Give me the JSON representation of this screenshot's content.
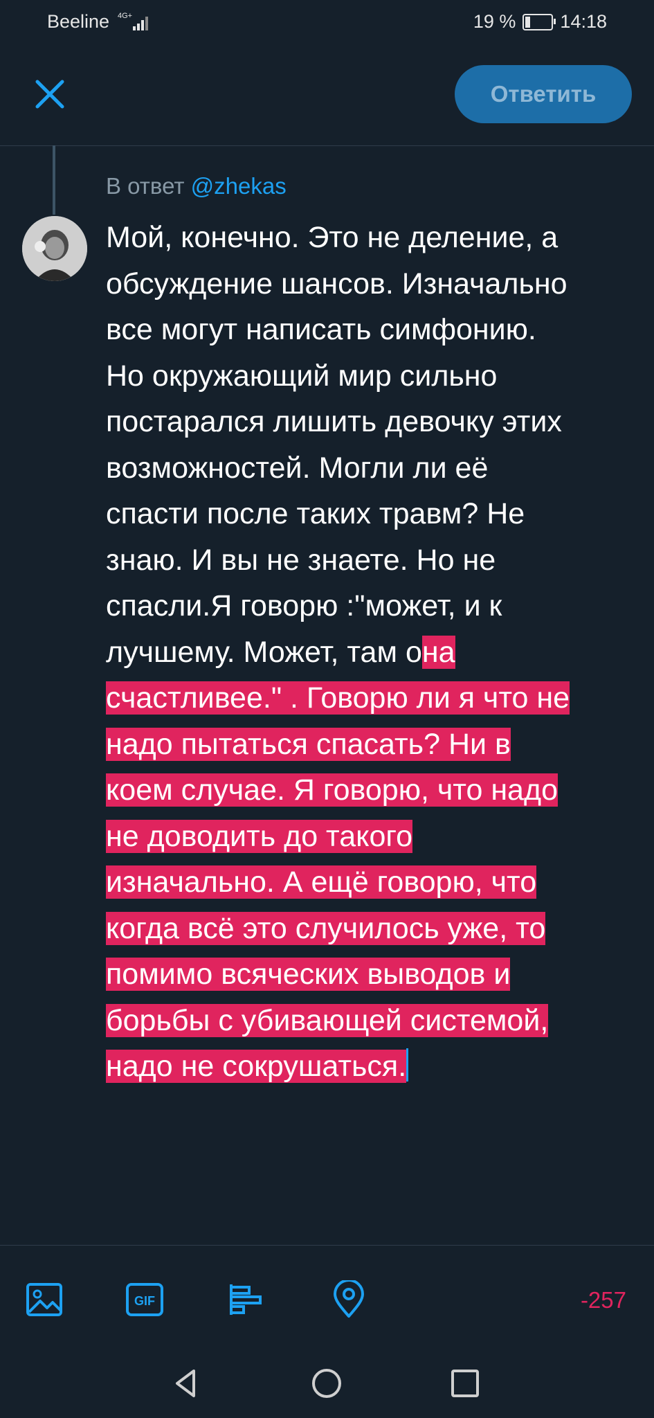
{
  "status_bar": {
    "carrier": "Beeline",
    "network": "4G+",
    "battery": "19 %",
    "time": "14:18"
  },
  "header": {
    "reply_button": "Ответить",
    "close_icon": "close-icon"
  },
  "reply": {
    "prefix": "В ответ",
    "handle": "@zhekas"
  },
  "tweet": {
    "text_plain": "Мой, конечно. Это не деление, а\nобсуждение шансов. Изначально\nвсе могут написать симфонию.\nНо окружающий мир сильно\nпостарался лишить девочку этих\nвозможностей. Могли ли её\nспасти после таких травм? Не\nзнаю. И вы не знаете. Но не\nспасли.Я говорю :\"может, и к\nлучшему. Может, там о",
    "text_selected": "на\nсчастливее.\" . Говорю ли я что не\nнадо пытаться спасать? Ни в\nкоем случае. Я говорю, что надо\nне доводить до такого\nизначально. А ещё говорю, что\nкогда всё это случилось уже, то\nпомимо всяческих выводов и\nборьбы с убивающей системой,\nнадо не сокрушаться."
  },
  "toolbar": {
    "icons": [
      "image-icon",
      "gif-icon",
      "poll-icon",
      "location-icon"
    ],
    "gif_label": "GIF",
    "char_counter": "-257"
  },
  "colors": {
    "background": "#15202b",
    "accent": "#1da1f2",
    "selection": "#e0245e",
    "muted": "#8899a6"
  }
}
